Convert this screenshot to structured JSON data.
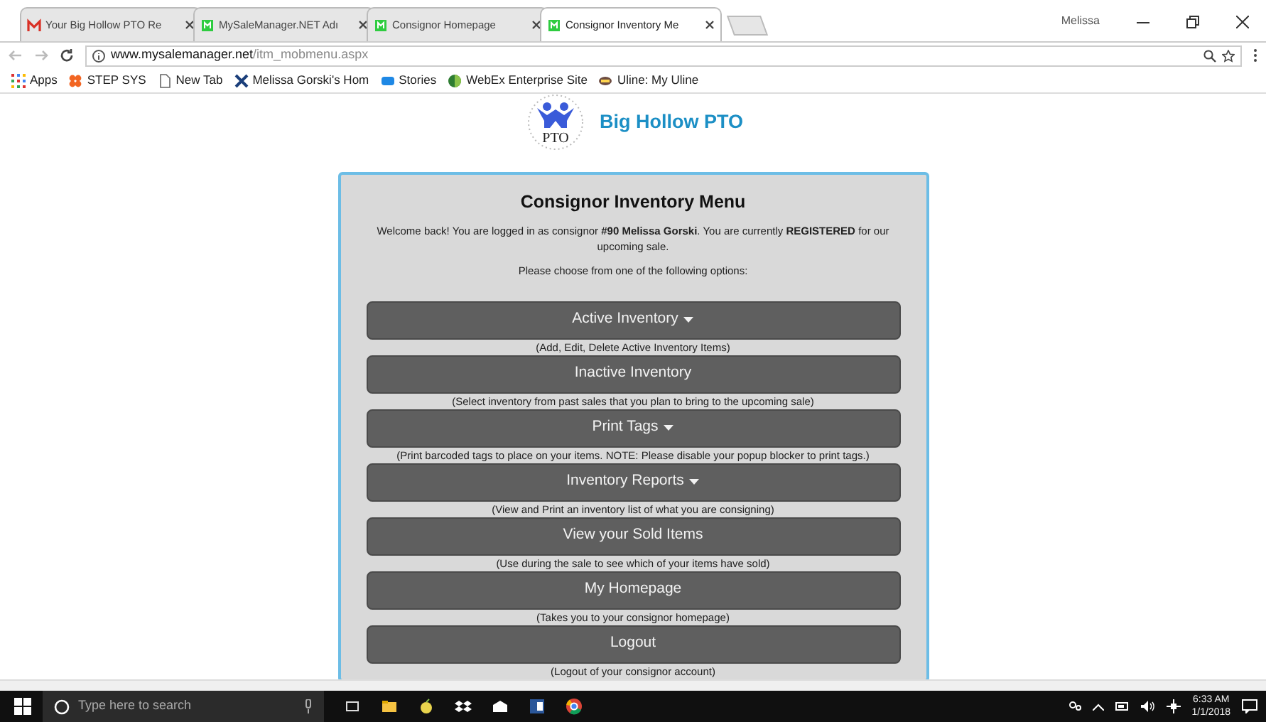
{
  "browser_tabs": [
    {
      "title": "Your Big Hollow PTO Re",
      "selected": false
    },
    {
      "title": "MySaleManager.NET Adı",
      "selected": false
    },
    {
      "title": "Consignor Homepage",
      "selected": false
    },
    {
      "title": "Consignor Inventory Me",
      "selected": true
    }
  ],
  "window_user": "Melissa",
  "address": {
    "domain": "www.mysalemanager.net",
    "path": "/itm_mobmenu.aspx"
  },
  "bookmarks": [
    {
      "label": "Apps"
    },
    {
      "label": "STEP SYS"
    },
    {
      "label": "New Tab"
    },
    {
      "label": "Melissa Gorski's Hom"
    },
    {
      "label": "Stories"
    },
    {
      "label": "WebEx Enterprise Site"
    },
    {
      "label": "Uline: My Uline"
    }
  ],
  "page": {
    "logo_text": "PTO",
    "brand": "Big Hollow PTO",
    "title": "Consignor Inventory Menu",
    "welcome": "Welcome back! You are logged in as consignor **#90 Melissa Gorski**.  You are currently **REGISTERED** for our upcoming sale.",
    "prompt": "Please choose from one of the following options:",
    "menu": [
      {
        "label": "Active Inventory",
        "dropdown": true,
        "description": "(Add, Edit, Delete Active Inventory Items)"
      },
      {
        "label": "Inactive Inventory",
        "dropdown": false,
        "description": "(Select inventory from past sales that you plan to bring to the upcoming sale)"
      },
      {
        "label": "Print Tags",
        "dropdown": true,
        "description": "(Print barcoded tags to place on your items. NOTE: Please disable your popup blocker to print tags.)"
      },
      {
        "label": "Inventory Reports",
        "dropdown": true,
        "description": "(View and Print an inventory list of what you are consigning)"
      },
      {
        "label": "View your Sold Items",
        "dropdown": false,
        "description": "(Use during the sale to see which of your items have sold)"
      },
      {
        "label": "My Homepage",
        "dropdown": false,
        "description": "(Takes you to your consignor homepage)"
      },
      {
        "label": "Logout",
        "dropdown": false,
        "description": "(Logout of your consignor account)"
      }
    ]
  },
  "taskbar": {
    "search_placeholder": "Type here to search",
    "time": "6:33 AM",
    "date": "1/1/2018"
  }
}
